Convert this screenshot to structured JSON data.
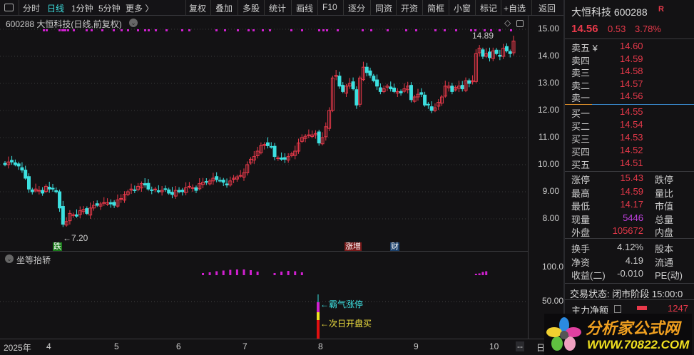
{
  "toolbar": {
    "left": [
      "分时",
      "日线",
      "1分钟",
      "5分钟",
      "更多 〉"
    ],
    "active": "日线",
    "right": [
      "复权",
      "叠加",
      "多股",
      "统计",
      "画线",
      "F10",
      "逐分",
      "同资",
      "开资",
      "简框",
      "小窗",
      "标记",
      "+自选",
      "返回"
    ]
  },
  "chart_title": "600288 大恒科技(日线,前复权)",
  "stock": {
    "name": "大恒科技 600288",
    "badge": "R",
    "price": "14.56",
    "change": "0.53",
    "pct": "3.78%"
  },
  "asks": [
    {
      "label": "卖五 ¥",
      "price": "14.60"
    },
    {
      "label": "卖四",
      "price": "14.59"
    },
    {
      "label": "卖三",
      "price": "14.58"
    },
    {
      "label": "卖二",
      "price": "14.57"
    },
    {
      "label": "卖一",
      "price": "14.56"
    }
  ],
  "bids": [
    {
      "label": "买一",
      "price": "14.55"
    },
    {
      "label": "买二",
      "price": "14.54"
    },
    {
      "label": "买三",
      "price": "14.53"
    },
    {
      "label": "买四",
      "price": "14.52"
    },
    {
      "label": "买五",
      "price": "14.51"
    }
  ],
  "stats": [
    {
      "l": "涨停",
      "v": "15.43",
      "r": "跌停"
    },
    {
      "l": "最高",
      "v": "14.59",
      "r": "量比"
    },
    {
      "l": "最低",
      "v": "14.17",
      "r": "市值"
    },
    {
      "l": "现量",
      "v": "5446",
      "r": "总量"
    },
    {
      "l": "外盘",
      "v": "105672",
      "r": "内盘"
    }
  ],
  "fund": [
    {
      "l": "换手",
      "v": "4.12%",
      "r": "股本"
    },
    {
      "l": "净资",
      "v": "4.19",
      "r": "流通"
    },
    {
      "l": "收益(二)",
      "v": "-0.010",
      "r": "PE(动)"
    }
  ],
  "trade_status": "交易状态: 闭市阶段 15:00:0",
  "main_net": {
    "label": "主力净额",
    "value": "1247"
  },
  "indicator": {
    "name": "坐等抬轿",
    "label_top": "←霸气涨停",
    "label_bottom": "←次日开盘买",
    "ylabels": [
      "100.0",
      "50.00"
    ]
  },
  "annotations": {
    "low": "←7.20",
    "high": "14.89",
    "tag_fall": "跌",
    "tag_rise": "涨增",
    "tag_fin": "财"
  },
  "xaxis": {
    "labels": [
      "2025年",
      "4",
      "5",
      "6",
      "7",
      "8",
      "9",
      "10",
      "--",
      "日"
    ]
  },
  "watermark": {
    "title": "分析家公式网",
    "url": "WWW.70822.COM"
  },
  "chart_data": {
    "type": "candlestick",
    "yticks": [
      "15.00",
      "14.00",
      "13.00",
      "12.00",
      "11.00",
      "10.00",
      "9.00",
      "8.00"
    ],
    "ylim": [
      7.1,
      15.5
    ],
    "closes": [
      10.0,
      10.1,
      10.1,
      10.0,
      9.95,
      9.8,
      9.5,
      9.1,
      9.0,
      9.1,
      9.05,
      8.95,
      9.2,
      9.1,
      9.1,
      9.0,
      8.4,
      7.8,
      7.9,
      8.2,
      8.15,
      8.1,
      8.3,
      8.35,
      8.2,
      8.4,
      8.5,
      8.5,
      8.55,
      8.6,
      8.6,
      8.55,
      8.5,
      8.7,
      8.75,
      8.9,
      9.0,
      9.1,
      9.05,
      9.2,
      9.3,
      9.25,
      9.1,
      9.05,
      9.1,
      9.0,
      9.05,
      9.1,
      8.95,
      8.9,
      9.05,
      9.0,
      9.0,
      9.15,
      9.2,
      9.15,
      9.05,
      9.3,
      9.35,
      9.35,
      9.4,
      9.5,
      9.45,
      9.4,
      9.35,
      9.25,
      9.4,
      9.5,
      9.55,
      9.6,
      9.7,
      10.0,
      10.2,
      10.3,
      10.5,
      10.7,
      10.75,
      10.7,
      10.65,
      10.3,
      10.25,
      10.2,
      10.2,
      10.3,
      10.4,
      10.5,
      10.8,
      11.0,
      11.05,
      11.1,
      11.1,
      11.15,
      10.8,
      11.0,
      11.4,
      12.0,
      13.2,
      13.3,
      12.9,
      12.7,
      12.9,
      13.0,
      12.8,
      12.2,
      13.2,
      13.6,
      13.4,
      13.3,
      13.1,
      12.9,
      12.7,
      12.8,
      12.9,
      12.8,
      12.7,
      12.7,
      12.65,
      12.8,
      12.9,
      12.4,
      12.5,
      12.6,
      12.6,
      12.2,
      12.2,
      12.0,
      12.1,
      12.3,
      12.5,
      12.9,
      12.9,
      12.7,
      12.85,
      12.9,
      12.8,
      13.1,
      13.0,
      13.1,
      14.1,
      14.3,
      14.0,
      14.1,
      13.95,
      14.2,
      14.1,
      14.0,
      14.3,
      14.2,
      14.1,
      14.56
    ],
    "colors": {
      "up": "#e8394a",
      "down": "#3de0e0"
    },
    "indicator_values": {
      "signal_indices": [
        58,
        60,
        62,
        64,
        66,
        68,
        70,
        72,
        74,
        79,
        81,
        83,
        85,
        87,
        138,
        139,
        140,
        141
      ],
      "signal_levels": [
        30,
        40,
        55,
        65,
        75,
        80,
        80,
        70,
        50,
        30,
        50,
        60,
        55,
        40,
        20,
        25,
        45,
        55
      ]
    }
  }
}
